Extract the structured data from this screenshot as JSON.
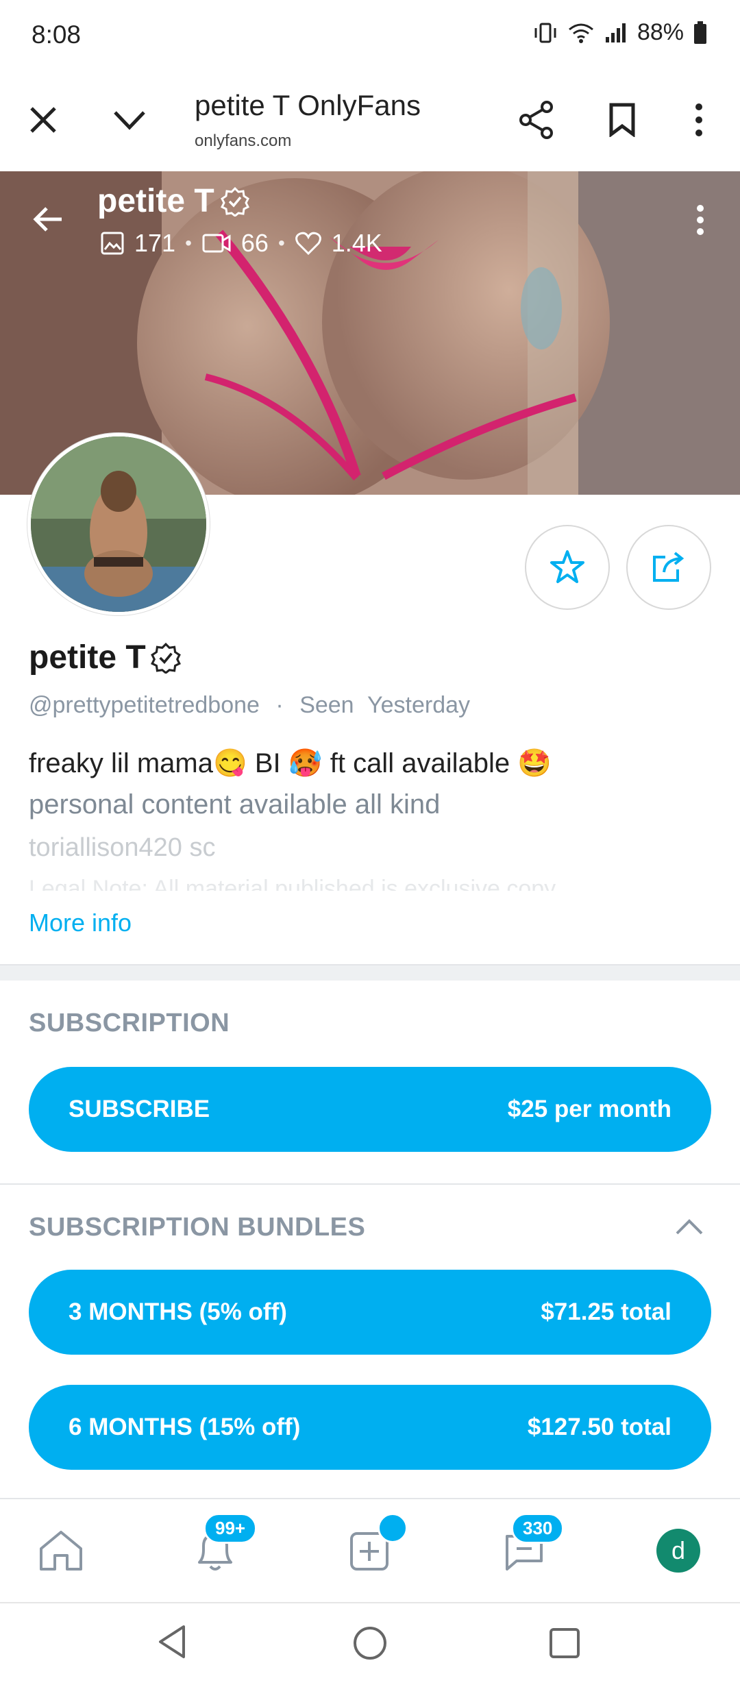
{
  "status_bar": {
    "time": "8:08",
    "battery": "88%",
    "icons": [
      "vibrate-icon",
      "wifi-icon",
      "signal-icon",
      "battery-icon"
    ]
  },
  "browser": {
    "title": "petite T OnlyFans",
    "url": "onlyfans.com",
    "icons": [
      "close-icon",
      "chevron-down-icon",
      "share-icon",
      "bookmark-icon",
      "more-vert-icon"
    ]
  },
  "cover": {
    "name": "petite T",
    "photos": "171",
    "videos": "66",
    "likes": "1.4K"
  },
  "profile": {
    "name": "petite T",
    "handle": "@prettypetitetredbone",
    "seen_label": "Seen",
    "seen_value": "Yesterday",
    "bio_line1_a": "freaky lil mama",
    "bio_line1_b": " BI ",
    "bio_line1_c": " ft call available ",
    "emoji1": "😋",
    "emoji2": "🥵",
    "emoji3": "🤩",
    "bio_line2": "personal content available all kind",
    "bio_line3": "toriallison420 sc",
    "bio_line4": "Legal Note: All material published is exclusive copy",
    "more_info": "More info"
  },
  "subscription": {
    "title": "SUBSCRIPTION",
    "button_label": "SUBSCRIBE",
    "button_price": "$25 per month"
  },
  "bundles": {
    "title": "SUBSCRIPTION BUNDLES",
    "items": [
      {
        "label": "3 MONTHS (5% off)",
        "price": "$71.25 total"
      },
      {
        "label": "6 MONTHS (15% off)",
        "price": "$127.50 total"
      }
    ]
  },
  "bottom_nav": {
    "notifications_badge": "99+",
    "messages_badge": "330",
    "avatar_letter": "d"
  },
  "colors": {
    "accent": "#00aff0",
    "muted": "#8a96a3",
    "avatar_green": "#128a6e"
  }
}
